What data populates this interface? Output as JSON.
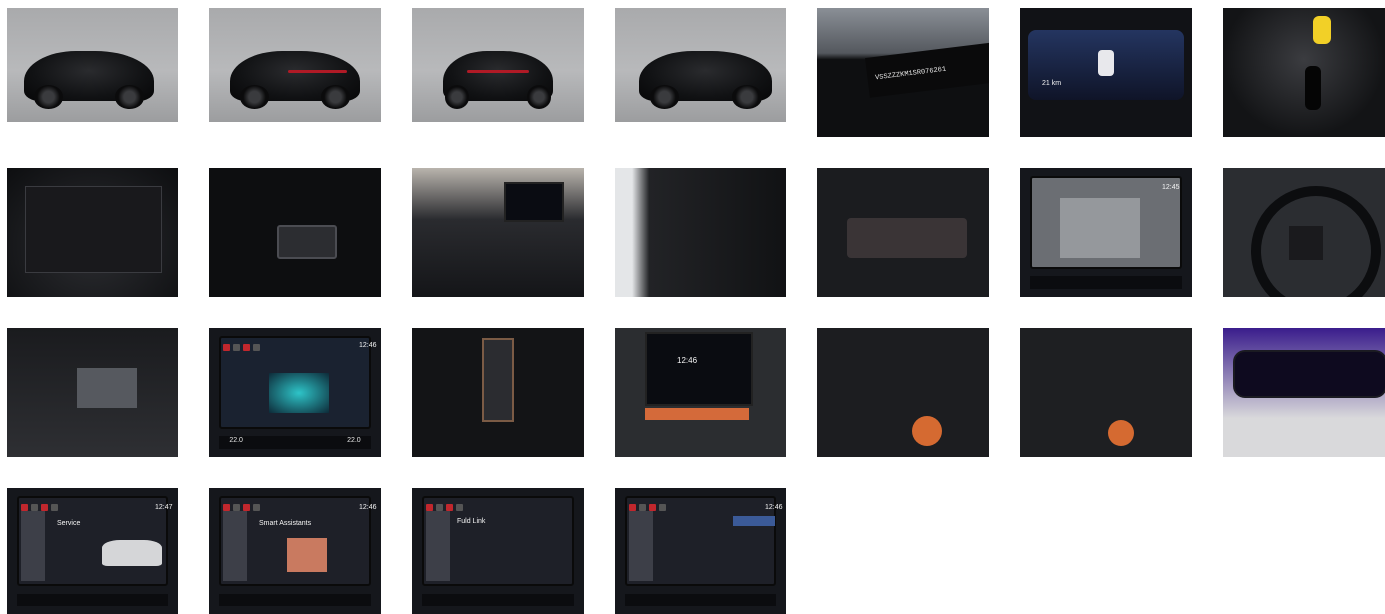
{
  "gallery": {
    "photos": [
      {
        "id": "p1",
        "kind": "front-34",
        "alt": ""
      },
      {
        "id": "p2",
        "kind": "rear-34-left",
        "alt": ""
      },
      {
        "id": "p3",
        "kind": "rear",
        "alt": ""
      },
      {
        "id": "p4",
        "kind": "front-34-right",
        "alt": ""
      },
      {
        "id": "p5",
        "kind": "vin-plate",
        "text": "VSSZZZKM1SR076261"
      },
      {
        "id": "p6",
        "kind": "digital-cluster",
        "text": "21 km"
      },
      {
        "id": "p7",
        "kind": "keys"
      },
      {
        "id": "p8",
        "kind": "trunk"
      },
      {
        "id": "p9",
        "kind": "trunk-button"
      },
      {
        "id": "p10",
        "kind": "dashboard"
      },
      {
        "id": "p11",
        "kind": "rear-seats"
      },
      {
        "id": "p12",
        "kind": "window-switches"
      },
      {
        "id": "p13",
        "kind": "parking-camera",
        "time": "12:45"
      },
      {
        "id": "p14",
        "kind": "steering-wheel"
      },
      {
        "id": "p15",
        "kind": "rear-vents"
      },
      {
        "id": "p16",
        "kind": "climate-screen",
        "time": "12:46",
        "temp_left": "22.0",
        "temp_right": "22.0"
      },
      {
        "id": "p17",
        "kind": "gear-selector"
      },
      {
        "id": "p18",
        "kind": "center-screen",
        "time": "12:46"
      },
      {
        "id": "p19",
        "kind": "wheel-buttons-drive"
      },
      {
        "id": "p20",
        "kind": "wheel-buttons"
      },
      {
        "id": "p21",
        "kind": "rearview-mirror"
      },
      {
        "id": "p22",
        "kind": "service-screen",
        "time": "12:47",
        "title": "Service"
      },
      {
        "id": "p23",
        "kind": "assistants-screen",
        "time": "12:46",
        "title": "Smart Assistants"
      },
      {
        "id": "p24",
        "kind": "fulllink-screen",
        "title": "Fuld Link"
      },
      {
        "id": "p25",
        "kind": "phone-screen",
        "time": "12:46"
      }
    ]
  },
  "colors": {
    "accent": "#e6814a",
    "brand_red": "#b01a26"
  }
}
